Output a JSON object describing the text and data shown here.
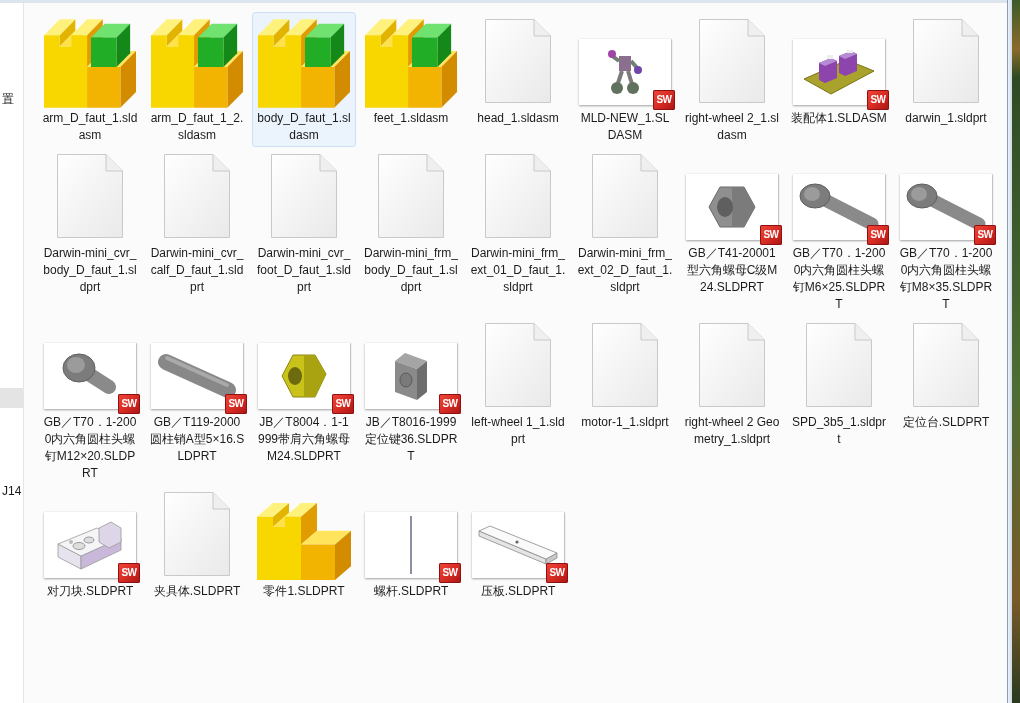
{
  "sidebar": {
    "items": [
      {
        "label": "置",
        "selected": false
      },
      {
        "selected": true
      },
      {
        "label": "J14",
        "selected": false
      }
    ]
  },
  "files": [
    {
      "name": "arm_D_faut_1.sldasm",
      "kind": "assembly",
      "selected": false
    },
    {
      "name": "arm_D_faut_1_2.sldasm",
      "kind": "assembly",
      "selected": false
    },
    {
      "name": "body_D_faut_1.sldasm",
      "kind": "assembly",
      "selected": true
    },
    {
      "name": "feet_1.sldasm",
      "kind": "assembly",
      "selected": false
    },
    {
      "name": "head_1.sldasm",
      "kind": "document",
      "selected": false
    },
    {
      "name": "MLD-NEW_1.SLDASM",
      "kind": "robot",
      "badge": "SW",
      "selected": false
    },
    {
      "name": "right-wheel 2_1.sldasm",
      "kind": "document",
      "selected": false
    },
    {
      "name": "装配体1.SLDASM",
      "kind": "mount",
      "badge": "SW",
      "selected": false
    },
    {
      "name": "darwin_1.sldprt",
      "kind": "document",
      "selected": false
    },
    {
      "name": "Darwin-mini_cvr_body_D_faut_1.sldprt",
      "kind": "document",
      "selected": false
    },
    {
      "name": "Darwin-mini_cvr_calf_D_faut_1.sldprt",
      "kind": "document",
      "selected": false
    },
    {
      "name": "Darwin-mini_cvr_foot_D_faut_1.sldprt",
      "kind": "document",
      "selected": false
    },
    {
      "name": "Darwin-mini_frm_body_D_faut_1.sldprt",
      "kind": "document",
      "selected": false
    },
    {
      "name": "Darwin-mini_frm_ext_01_D_faut_1.sldprt",
      "kind": "document",
      "selected": false
    },
    {
      "name": "Darwin-mini_frm_ext_02_D_faut_1.sldprt",
      "kind": "document",
      "selected": false
    },
    {
      "name": "GB／T41-20001型六角螺母C级M24.SLDPRT",
      "kind": "nut",
      "badge": "SW",
      "selected": false
    },
    {
      "name": "GB／T70．1-2000内六角圆柱头螺钉M6×25.SLDPRT",
      "kind": "screw",
      "badge": "SW",
      "selected": false
    },
    {
      "name": "GB／T70．1-2000内六角圆柱头螺钉M8×35.SLDPRT",
      "kind": "screw",
      "badge": "SW",
      "selected": false
    },
    {
      "name": "GB／T70．1-2000内六角圆柱头螺钉M12×20.SLDPRT",
      "kind": "stubscrew",
      "badge": "SW",
      "selected": false
    },
    {
      "name": "GB／T119-2000圆柱销A型5×16.SLDPRT",
      "kind": "pin",
      "badge": "SW",
      "selected": false
    },
    {
      "name": "JB／T8004．1-1999带肩六角螺母M24.SLDPRT",
      "kind": "flangenut",
      "badge": "SW",
      "selected": false
    },
    {
      "name": "JB／T8016-1999定位键36.SLDPRT",
      "kind": "key",
      "badge": "SW",
      "selected": false
    },
    {
      "name": "left-wheel 1_1.sldprt",
      "kind": "document",
      "selected": false
    },
    {
      "name": "motor-1_1.sldprt",
      "kind": "document",
      "selected": false
    },
    {
      "name": "right-wheel 2 Geometry_1.sldprt",
      "kind": "document",
      "selected": false
    },
    {
      "name": "SPD_3b5_1.sldprt",
      "kind": "document",
      "selected": false
    },
    {
      "name": "定位台.SLDPRT",
      "kind": "document",
      "selected": false
    },
    {
      "name": "对刀块.SLDPRT",
      "kind": "block",
      "badge": "SW",
      "selected": false
    },
    {
      "name": "夹具体.SLDPRT",
      "kind": "document",
      "selected": false
    },
    {
      "name": "零件1.SLDPRT",
      "kind": "part",
      "selected": false
    },
    {
      "name": "螺杆.SLDPRT",
      "kind": "rod",
      "badge": "SW",
      "selected": false
    },
    {
      "name": "压板.SLDPRT",
      "kind": "plate",
      "badge": "SW",
      "selected": false
    }
  ]
}
